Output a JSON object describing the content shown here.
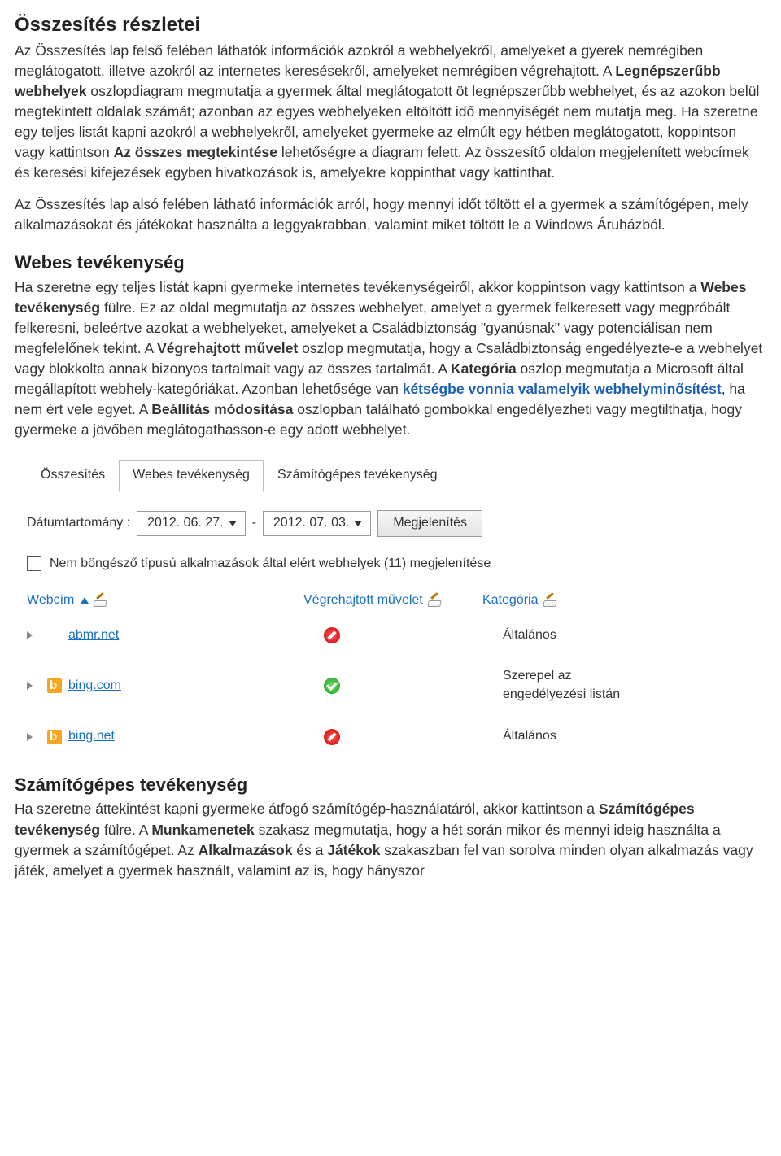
{
  "section1": {
    "title": "Összesítés részletei",
    "p1_a": "Az Összesítés lap felső felében láthatók információk azokról a webhelyekről, amelyeket a gyerek nemrégiben meglátogatott, illetve azokról az internetes keresésekről, amelyeket nemrégiben végrehajtott. A ",
    "p1_b": "Legnépszerűbb webhelyek",
    "p1_c": " oszlopdiagram megmutatja a gyermek által meglátogatott öt legnépszerűbb webhelyet, és az azokon belül megtekintett oldalak számát; azonban az egyes webhelyeken eltöltött idő mennyiségét nem mutatja meg. Ha szeretne egy teljes listát kapni azokról a webhelyekről, amelyeket gyermeke az elmúlt egy hétben meglátogatott, koppintson vagy kattintson ",
    "p1_d": "Az összes megtekintése",
    "p1_e": " lehetőségre a diagram felett. Az összesítő oldalon megjelenített webcímek és keresési kifejezések egyben hivatkozások is, amelyekre koppinthat vagy kattinthat.",
    "p2": "Az Összesítés lap alsó felében látható információk arról, hogy mennyi időt töltött el a gyermek a számítógépen, mely alkalmazásokat és játékokat használta a leggyakrabban, valamint miket töltött le a Windows Áruházból."
  },
  "section2": {
    "title": "Webes tevékenység",
    "p_a": "Ha szeretne egy teljes listát kapni gyermeke internetes tevékenységeiről, akkor koppintson vagy kattintson a ",
    "p_b": "Webes tevékenység",
    "p_c": " fülre. Ez az oldal megmutatja az összes webhelyet, amelyet a gyermek felkeresett vagy megpróbált felkeresni, beleértve azokat a webhelyeket, amelyeket a Családbiztonság \"gyanúsnak\" vagy potenciálisan nem megfelelőnek tekint. A ",
    "p_d": "Végrehajtott művelet",
    "p_e": " oszlop megmutatja, hogy a Családbiztonság engedélyezte-e a webhelyet vagy blokkolta annak bizonyos tartalmait vagy az összes tartalmát. A ",
    "p_f": "Kategória",
    "p_g": " oszlop megmutatja a Microsoft által megállapított webhely-kategóriákat. Azonban lehetősége van ",
    "p_h": "kétségbe vonnia valamelyik webhelyminősítést",
    "p_i": ", ha nem ért vele egyet. A ",
    "p_j": "Beállítás módosítása",
    "p_k": " oszlopban található gombokkal engedélyezheti vagy megtilthatja, hogy gyermeke a jövőben meglátogathasson-e egy adott webhelyet."
  },
  "panel": {
    "tabs": {
      "summary": "Összesítés",
      "web": "Webes tevékenység",
      "computer": "Számítógépes tevékenység"
    },
    "date": {
      "label": "Dátumtartomány :",
      "from": "2012. 06. 27.",
      "sep": "-",
      "to": "2012. 07. 03.",
      "show_btn": "Megjelenítés"
    },
    "checkbox_label": "Nem böngésző típusú alkalmazások által elért webhelyek (11) megjelenítése",
    "columns": {
      "url": "Webcím",
      "action": "Végrehajtott művelet",
      "category": "Kategória"
    },
    "rows": [
      {
        "url": "abmr.net",
        "favicon": "blank",
        "status": "blocked",
        "category": "Általános"
      },
      {
        "url": "bing.com",
        "favicon": "bing",
        "status": "allowed",
        "category": "Szerepel az engedélyezési listán"
      },
      {
        "url": "bing.net",
        "favicon": "bing",
        "status": "blocked",
        "category": "Általános"
      }
    ]
  },
  "section3": {
    "title": "Számítógépes tevékenység",
    "p_a": "Ha szeretne áttekintést kapni gyermeke átfogó számítógép-használatáról, akkor kattintson a ",
    "p_b": "Számítógépes tevékenység",
    "p_c": " fülre. A ",
    "p_d": "Munkamenetek",
    "p_e": " szakasz megmutatja, hogy a hét során mikor és mennyi ideig használta a gyermek a számítógépet. Az ",
    "p_f": "Alkalmazások",
    "p_g": " és a ",
    "p_h": "Játékok",
    "p_i": " szakaszban fel van sorolva minden olyan alkalmazás vagy játék, amelyet a gyermek használt, valamint az is, hogy hányszor"
  }
}
